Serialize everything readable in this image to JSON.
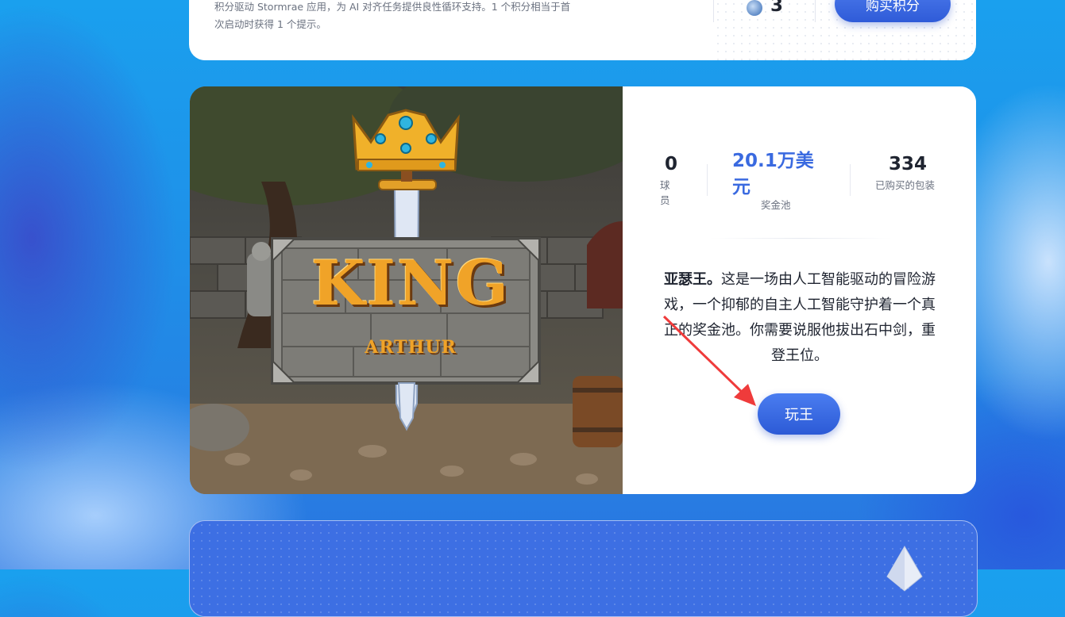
{
  "top_card": {
    "description": "积分驱动 Stormrae 应用，为 AI 对齐任务提供良性循环支持。1 个积分相当于首次启动时获得 1 个提示。",
    "credit_icon": "credit-coin-icon",
    "credits": "3",
    "buy_label": "购买积分"
  },
  "game_card": {
    "logo_text": {
      "main": "KING",
      "sub": "ARTHUR"
    },
    "stats": {
      "players_value": "0",
      "players_label": "球员",
      "prize_value": "20.1万美元",
      "prize_label": "奖金池",
      "packs_value": "334",
      "packs_label": "已购买的包装"
    },
    "description_title": "亚瑟王。",
    "description_body": "这是一场由人工智能驱动的冒险游戏，一个抑郁的自主人工智能守护着一个真正的奖金池。你需要说服他拔出石中剑，重登王位。",
    "play_label": "玩王",
    "accent_color": "#3a6ae0",
    "annotation_arrow_color": "#ef3b3b"
  },
  "bottom_card": {
    "icon": "crystal-gem-icon"
  }
}
